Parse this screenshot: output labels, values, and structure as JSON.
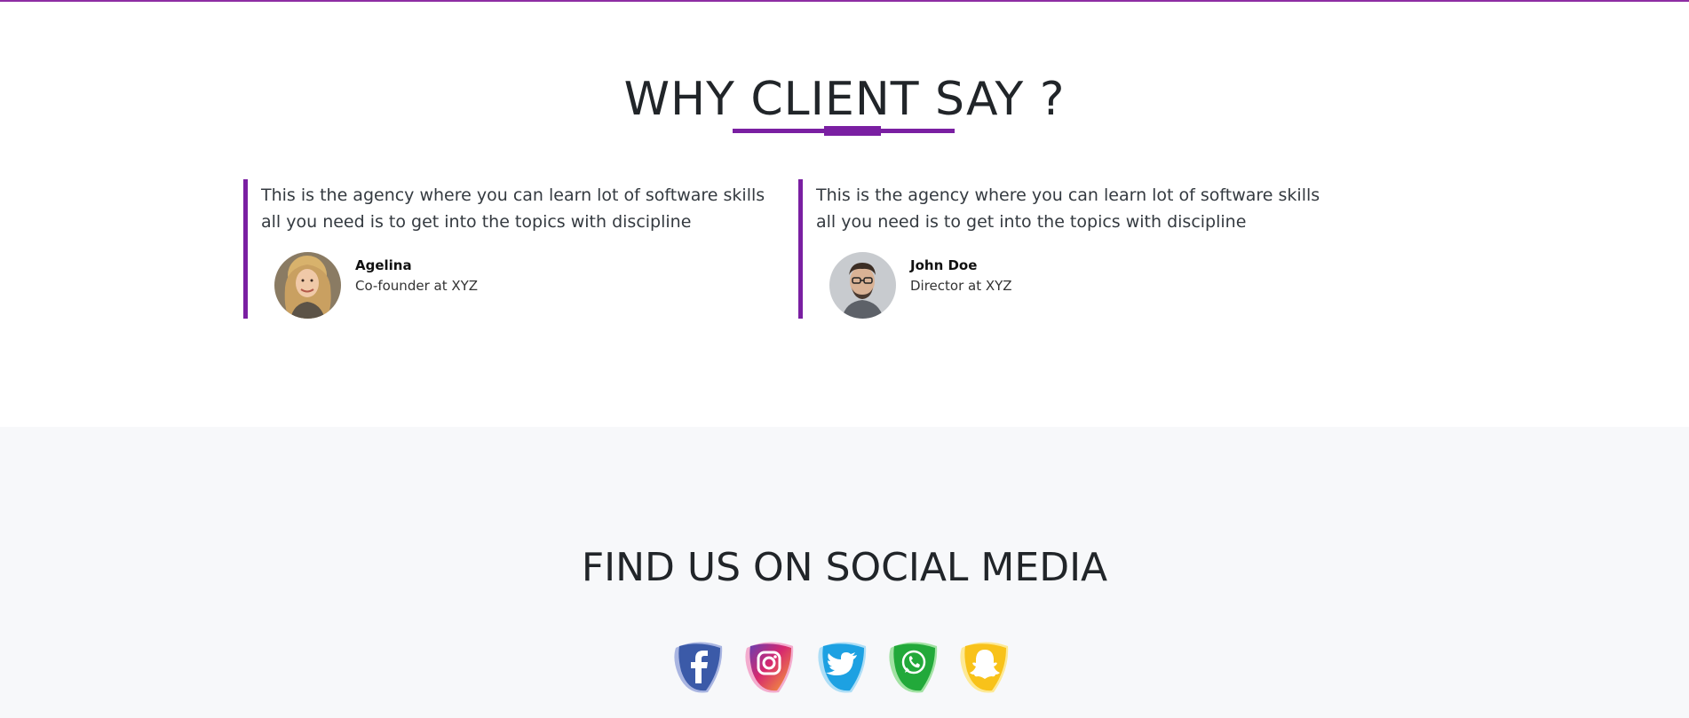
{
  "testimonials": {
    "title": "WHY CLIENT SAY ?",
    "items": [
      {
        "quote": "This is the agency where you can learn lot of software skills all you need is to get into the topics with discipline",
        "name": "Agelina",
        "role": "Co-founder at XYZ"
      },
      {
        "quote": "This is the agency where you can learn lot of software skills all you need is to get into the topics with discipline",
        "name": "John Doe",
        "role": "Director at XYZ"
      }
    ]
  },
  "social": {
    "title": "FIND US ON SOCIAL MEDIA",
    "icons": [
      "facebook-icon",
      "instagram-icon",
      "twitter-icon",
      "whatsapp-icon",
      "snapchat-icon"
    ]
  },
  "colors": {
    "accent": "#7a1fa2",
    "section_bg": "#f7f8fa"
  }
}
